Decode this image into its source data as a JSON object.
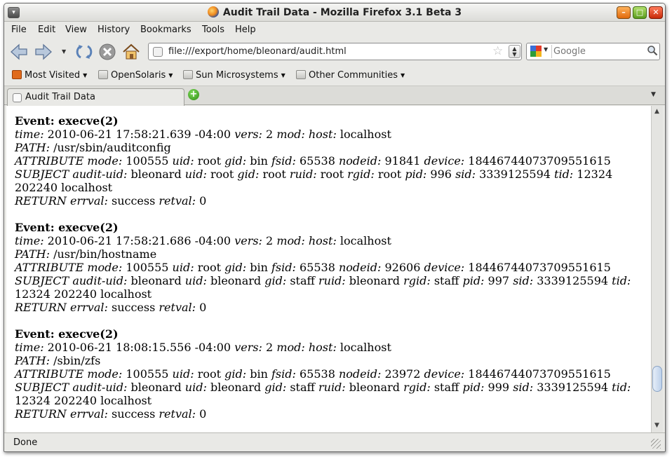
{
  "window": {
    "title": "Audit Trail Data - Mozilla Firefox 3.1 Beta 3"
  },
  "menubar": {
    "items": [
      "File",
      "Edit",
      "View",
      "History",
      "Bookmarks",
      "Tools",
      "Help"
    ]
  },
  "navigation": {
    "url": "file:///export/home/bleonard/audit.html",
    "search_placeholder": "Google",
    "icons": [
      "back-icon",
      "forward-icon",
      "history-dropdown-icon",
      "reload-icon",
      "stop-icon",
      "home-icon"
    ]
  },
  "bookmarks": {
    "items": [
      "Most Visited",
      "OpenSolaris",
      "Sun Microsystems",
      "Other Communities"
    ]
  },
  "tabs": [
    {
      "label": "Audit Trail Data"
    }
  ],
  "events": [
    {
      "title": "Event: execve(2)",
      "time_label": "time:",
      "time": "2010-06-21 17:58:21.639 -04:00",
      "vers_label": "vers:",
      "vers": "2",
      "mod_label": "mod:",
      "host_label": "host:",
      "host": "localhost",
      "path_label": "PATH:",
      "path": "/usr/sbin/auditconfig",
      "attr_label": "ATTRIBUTE",
      "attr_mode_label": "mode:",
      "attr_mode": "100555",
      "attr_uid_label": "uid:",
      "attr_uid": "root",
      "attr_gid_label": "gid:",
      "attr_gid": "bin",
      "attr_fsid_label": "fsid:",
      "attr_fsid": "65538",
      "attr_nodeid_label": "nodeid:",
      "attr_nodeid": "91841",
      "attr_device_label": "device:",
      "attr_device": "18446744073709551615",
      "subj_label": "SUBJECT",
      "subj_audit_uid_label": "audit-uid:",
      "subj_audit_uid": "bleonard",
      "subj_uid_label": "uid:",
      "subj_uid": "root",
      "subj_gid_label": "gid:",
      "subj_gid": "root",
      "subj_ruid_label": "ruid:",
      "subj_ruid": "root",
      "subj_rgid_label": "rgid:",
      "subj_rgid": "root",
      "subj_pid_label": "pid:",
      "subj_pid": "996",
      "subj_sid_label": "sid:",
      "subj_sid": "3339125594",
      "subj_tid_label": "tid:",
      "subj_tid": "12324 202240 localhost",
      "ret_label": "RETURN",
      "errval_label": "errval:",
      "errval": "success",
      "retval_label": "retval:",
      "retval": "0"
    },
    {
      "title": "Event: execve(2)",
      "time_label": "time:",
      "time": "2010-06-21 17:58:21.686 -04:00",
      "vers_label": "vers:",
      "vers": "2",
      "mod_label": "mod:",
      "host_label": "host:",
      "host": "localhost",
      "path_label": "PATH:",
      "path": "/usr/bin/hostname",
      "attr_label": "ATTRIBUTE",
      "attr_mode_label": "mode:",
      "attr_mode": "100555",
      "attr_uid_label": "uid:",
      "attr_uid": "root",
      "attr_gid_label": "gid:",
      "attr_gid": "bin",
      "attr_fsid_label": "fsid:",
      "attr_fsid": "65538",
      "attr_nodeid_label": "nodeid:",
      "attr_nodeid": "92606",
      "attr_device_label": "device:",
      "attr_device": "18446744073709551615",
      "subj_label": "SUBJECT",
      "subj_audit_uid_label": "audit-uid:",
      "subj_audit_uid": "bleonard",
      "subj_uid_label": "uid:",
      "subj_uid": "bleonard",
      "subj_gid_label": "gid:",
      "subj_gid": "staff",
      "subj_ruid_label": "ruid:",
      "subj_ruid": "bleonard",
      "subj_rgid_label": "rgid:",
      "subj_rgid": "staff",
      "subj_pid_label": "pid:",
      "subj_pid": "997",
      "subj_sid_label": "sid:",
      "subj_sid": "3339125594",
      "subj_tid_label": "tid:",
      "subj_tid": "12324 202240 localhost",
      "ret_label": "RETURN",
      "errval_label": "errval:",
      "errval": "success",
      "retval_label": "retval:",
      "retval": "0"
    },
    {
      "title": "Event: execve(2)",
      "time_label": "time:",
      "time": "2010-06-21 18:08:15.556 -04:00",
      "vers_label": "vers:",
      "vers": "2",
      "mod_label": "mod:",
      "host_label": "host:",
      "host": "localhost",
      "path_label": "PATH:",
      "path": "/sbin/zfs",
      "attr_label": "ATTRIBUTE",
      "attr_mode_label": "mode:",
      "attr_mode": "100555",
      "attr_uid_label": "uid:",
      "attr_uid": "root",
      "attr_gid_label": "gid:",
      "attr_gid": "bin",
      "attr_fsid_label": "fsid:",
      "attr_fsid": "65538",
      "attr_nodeid_label": "nodeid:",
      "attr_nodeid": "23972",
      "attr_device_label": "device:",
      "attr_device": "18446744073709551615",
      "subj_label": "SUBJECT",
      "subj_audit_uid_label": "audit-uid:",
      "subj_audit_uid": "bleonard",
      "subj_uid_label": "uid:",
      "subj_uid": "bleonard",
      "subj_gid_label": "gid:",
      "subj_gid": "staff",
      "subj_ruid_label": "ruid:",
      "subj_ruid": "bleonard",
      "subj_rgid_label": "rgid:",
      "subj_rgid": "staff",
      "subj_pid_label": "pid:",
      "subj_pid": "999",
      "subj_sid_label": "sid:",
      "subj_sid": "3339125594",
      "subj_tid_label": "tid:",
      "subj_tid": "12324 202240 localhost",
      "ret_label": "RETURN",
      "errval_label": "errval:",
      "errval": "success",
      "retval_label": "retval:",
      "retval": "0"
    }
  ],
  "status": {
    "text": "Done"
  },
  "colors": {
    "accent": "#2e8a13",
    "close": "#c72b0a",
    "minimize": "#e0690c",
    "maximize": "#5b9c1e"
  }
}
